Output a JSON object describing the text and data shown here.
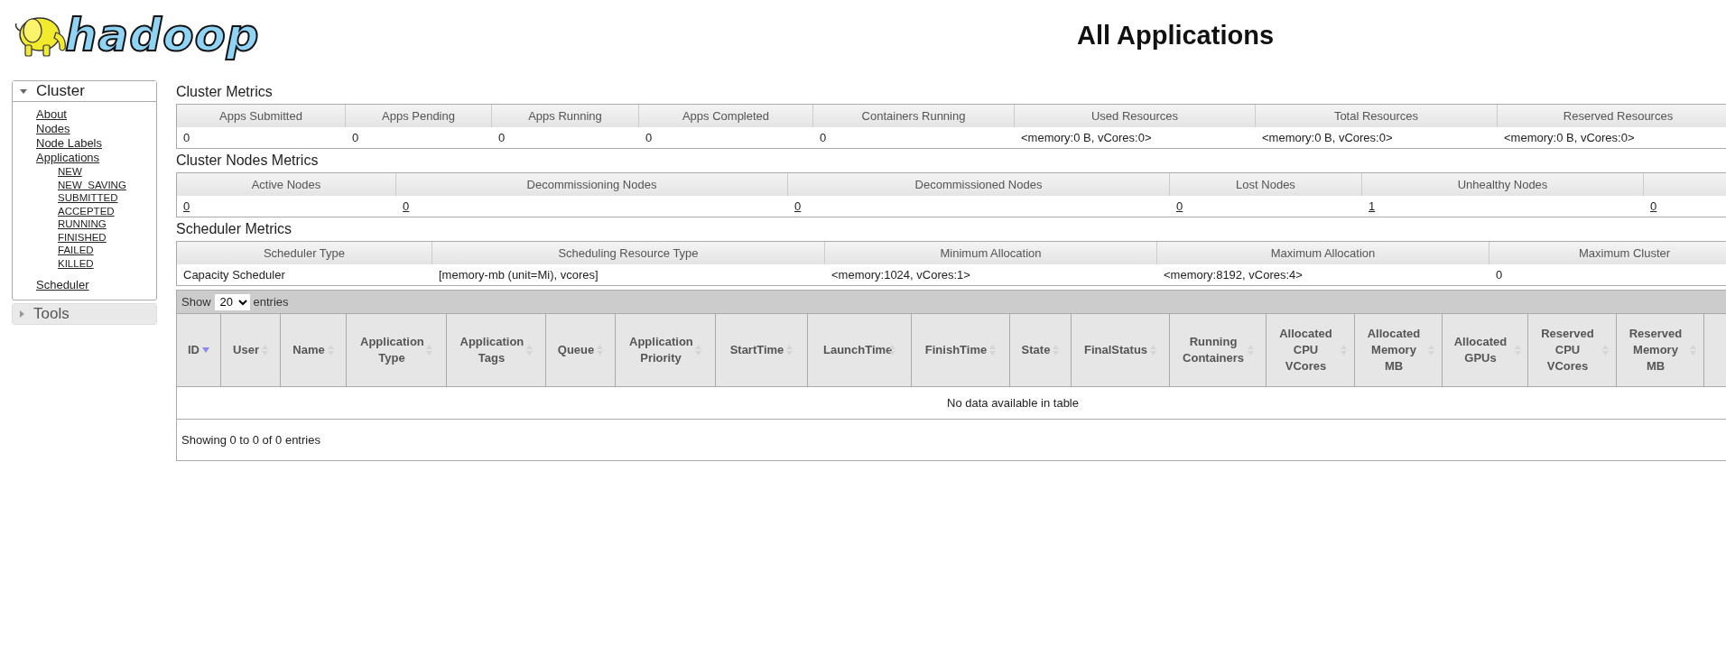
{
  "logo": {
    "text": "hadoop"
  },
  "page_title": "All Applications",
  "sidebar": {
    "sections": [
      {
        "label": "Cluster",
        "expanded": true,
        "items": [
          {
            "label": "About"
          },
          {
            "label": "Nodes"
          },
          {
            "label": "Node Labels"
          },
          {
            "label": "Applications",
            "children": [
              {
                "label": "NEW"
              },
              {
                "label": "NEW_SAVING"
              },
              {
                "label": "SUBMITTED"
              },
              {
                "label": "ACCEPTED"
              },
              {
                "label": "RUNNING"
              },
              {
                "label": "FINISHED"
              },
              {
                "label": "FAILED"
              },
              {
                "label": "KILLED"
              }
            ]
          },
          {
            "label": "Scheduler"
          }
        ]
      },
      {
        "label": "Tools",
        "expanded": false
      }
    ]
  },
  "metrics": [
    {
      "title": "Cluster Metrics",
      "links": false,
      "columns": [
        "Apps Submitted",
        "Apps Pending",
        "Apps Running",
        "Apps Completed",
        "Containers Running",
        "Used Resources",
        "Total Resources",
        "Reserved Resources"
      ],
      "values": [
        "0",
        "0",
        "0",
        "0",
        "0",
        "<memory:0 B, vCores:0>",
        "<memory:0 B, vCores:0>",
        "<memory:0 B, vCores:0>"
      ]
    },
    {
      "title": "Cluster Nodes Metrics",
      "links": true,
      "columns": [
        "Active Nodes",
        "Decommissioning Nodes",
        "Decommissioned Nodes",
        "Lost Nodes",
        "Unhealthy Nodes"
      ],
      "values": [
        "0",
        "0",
        "0",
        "0",
        "1",
        "0"
      ]
    },
    {
      "title": "Scheduler Metrics",
      "links": false,
      "columns": [
        "Scheduler Type",
        "Scheduling Resource Type",
        "Minimum Allocation",
        "Maximum Allocation",
        "Maximum Cluster"
      ],
      "values": [
        "Capacity Scheduler",
        "[memory-mb (unit=Mi), vcores]",
        "<memory:1024, vCores:1>",
        "<memory:8192, vCores:4>",
        "0"
      ]
    }
  ],
  "applications": {
    "show_label": "Show",
    "page_length": "20",
    "entries_label": "entries",
    "columns": [
      {
        "label": "ID",
        "sorted": true
      },
      {
        "label": "User",
        "sorted": false
      },
      {
        "label": "Name",
        "sorted": false
      },
      {
        "label": "Application Type",
        "sorted": false
      },
      {
        "label": "Application Tags",
        "sorted": false
      },
      {
        "label": "Queue",
        "sorted": false
      },
      {
        "label": "Application Priority",
        "sorted": false
      },
      {
        "label": "StartTime",
        "sorted": false
      },
      {
        "label": "LaunchTime",
        "sorted": false
      },
      {
        "label": "FinishTime",
        "sorted": false
      },
      {
        "label": "State",
        "sorted": false
      },
      {
        "label": "FinalStatus",
        "sorted": false
      },
      {
        "label": "Running Containers",
        "sorted": false
      },
      {
        "label": "Allocated CPU VCores",
        "sorted": false
      },
      {
        "label": "Allocated Memory MB",
        "sorted": false
      },
      {
        "label": "Allocated GPUs",
        "sorted": false
      },
      {
        "label": "Reserved CPU VCores",
        "sorted": false
      },
      {
        "label": "Reserved Memory MB",
        "sorted": false
      }
    ],
    "empty_message": "No data available in table",
    "info": "Showing 0 to 0 of 0 entries"
  }
}
